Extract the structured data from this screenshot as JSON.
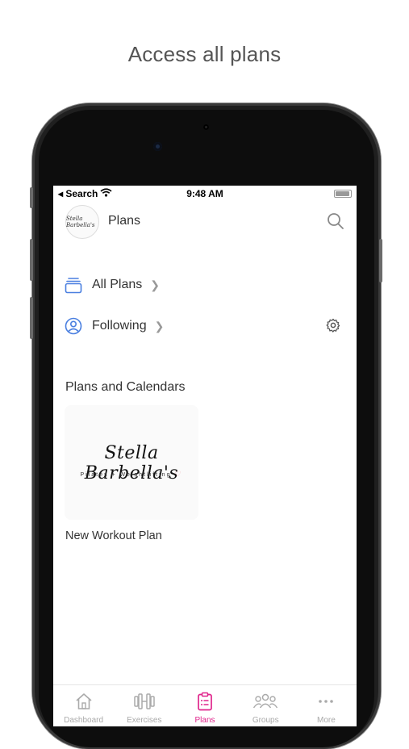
{
  "caption": "Access all plans",
  "status_bar": {
    "back_label": "◂ Search",
    "time": "9:48 AM"
  },
  "header": {
    "avatar_text": "Stella Barbella's",
    "title": "Plans"
  },
  "menu": {
    "all_plans": "All Plans",
    "following": "Following"
  },
  "section": {
    "title": "Plans and Calendars"
  },
  "plan": {
    "brand_name": "Stella Barbella's",
    "brand_tagline": "Pilates + Weightlifting",
    "name": "New Workout Plan"
  },
  "tabs": [
    {
      "label": "Dashboard",
      "icon": "house-icon"
    },
    {
      "label": "Exercises",
      "icon": "dumbbell-icon"
    },
    {
      "label": "Plans",
      "icon": "clipboard-icon",
      "active": true
    },
    {
      "label": "Groups",
      "icon": "people-icon"
    },
    {
      "label": "More",
      "icon": "ellipsis-icon"
    }
  ],
  "colors": {
    "accent": "#e0258c",
    "icon_blue": "#4a7fe0",
    "inactive_tab": "#aaaaaa"
  }
}
